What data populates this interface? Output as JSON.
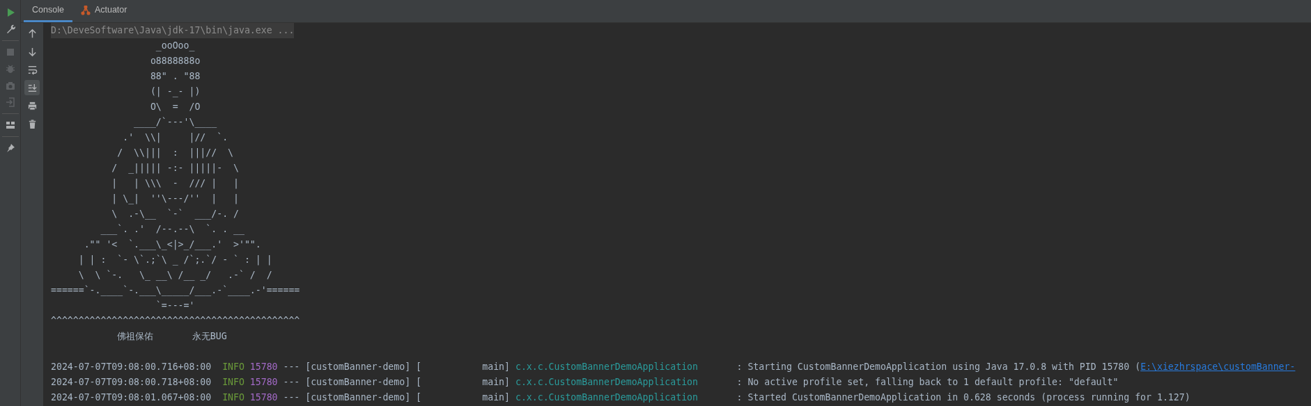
{
  "side_toolbar": [
    {
      "disabled": false
    },
    {
      "disabled": false
    },
    {
      "disabled": true
    },
    {
      "disabled": true
    },
    {
      "disabled": true
    },
    {
      "disabled": true
    },
    {
      "disabled": false
    },
    {
      "disabled": false
    }
  ],
  "tabs": [
    {
      "label": "Console",
      "selected": true
    },
    {
      "label": "Actuator",
      "selected": false
    }
  ],
  "console_toolbar": [
    {
      "on": false
    },
    {
      "on": false
    },
    {
      "on": false
    },
    {
      "on": true
    },
    {
      "on": false
    },
    {
      "on": false
    }
  ],
  "console": {
    "command": "D:\\DeveSoftware\\Java\\jdk-17\\bin\\java.exe ...",
    "banner": [
      "                   _ooOoo_",
      "                  o8888888o",
      "                  88\" . \"88",
      "                  (| -_- |)",
      "                  O\\  =  /O",
      "               ____/`---'\\____",
      "             .'  \\\\|     |//  `.",
      "            /  \\\\|||  :  |||//  \\",
      "           /  _||||| -:- |||||-  \\",
      "           |   | \\\\\\  -  /// |   |",
      "           | \\_|  ''\\---/''  |   |",
      "           \\  .-\\__  `-`  ___/-. /",
      "         ___`. .'  /--.--\\  `. . __",
      "      .\"\" '<  `.___\\_<|>_/___.'  >'\"\".",
      "     | | :  `- \\`.;`\\ _ /`;.`/ - ` : | |",
      "     \\  \\ `-.   \\_ __\\ /__ _/   .-` /  /",
      "======`-.____`-.___\\_____/___.-`____.-'======",
      "                   `=---='",
      "^^^^^^^^^^^^^^^^^^^^^^^^^^^^^^^^^^^^^^^^^^^^^",
      "            佛祖保佑       永无BUG"
    ],
    "log": [
      {
        "timestamp": "2024-07-07T09:08:00.716+08:00",
        "level": "INFO",
        "pid": "15780",
        "separator": "---",
        "app": "[customBanner-demo]",
        "thread": "[           main]",
        "logger": "c.x.c.CustomBannerDemoApplication",
        "message": ": Starting CustomBannerDemoApplication using Java 17.0.8 with PID 15780 (",
        "link": "E:\\xiezhrspace\\customBanner-"
      },
      {
        "timestamp": "2024-07-07T09:08:00.718+08:00",
        "level": "INFO",
        "pid": "15780",
        "separator": "---",
        "app": "[customBanner-demo]",
        "thread": "[           main]",
        "logger": "c.x.c.CustomBannerDemoApplication",
        "message": ": No active profile set, falling back to 1 default profile: \"default\""
      },
      {
        "timestamp": "2024-07-07T09:08:01.067+08:00",
        "level": "INFO",
        "pid": "15780",
        "separator": "---",
        "app": "[customBanner-demo]",
        "thread": "[           main]",
        "logger": "c.x.c.CustomBannerDemoApplication",
        "message": ": Started CustomBannerDemoApplication in 0.628 seconds (process running for 1.127)"
      }
    ]
  }
}
